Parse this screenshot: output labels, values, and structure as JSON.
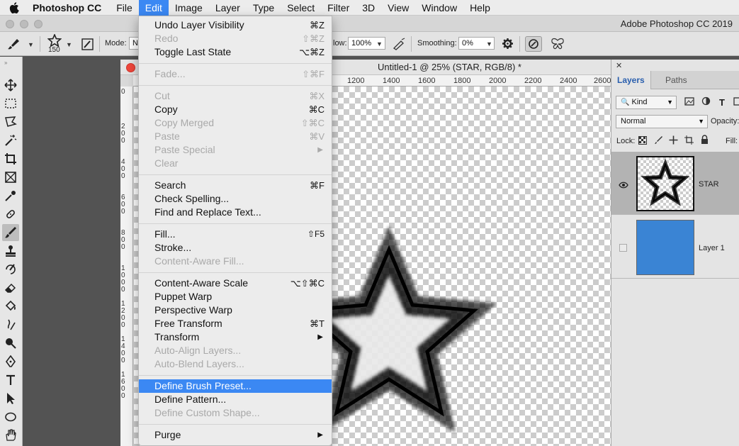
{
  "menubar": {
    "app_name": "Photoshop CC",
    "items": [
      "File",
      "Edit",
      "Image",
      "Layer",
      "Type",
      "Select",
      "Filter",
      "3D",
      "View",
      "Window",
      "Help"
    ],
    "active": "Edit"
  },
  "window": {
    "app_title": "Adobe Photoshop CC 2019"
  },
  "options": {
    "brush_size": "150",
    "mode_label": "Mode:",
    "mode_value": "N",
    "flow_label": "low:",
    "flow_value": "100%",
    "smoothing_label": "Smoothing:",
    "smoothing_value": "0%"
  },
  "document": {
    "title": "Untitled-1 @ 25% (STAR, RGB/8) *",
    "ruler_h": [
      "1200",
      "1400",
      "1600",
      "1800",
      "2000",
      "2200",
      "2400",
      "2600"
    ],
    "ruler_v": [
      "0",
      "2\n0\n0",
      "4\n0\n0",
      "6\n0\n0",
      "8\n0\n0",
      "1\n0\n0\n0",
      "1\n2\n0\n0",
      "1\n4\n0\n0",
      "1\n6\n0\n0"
    ]
  },
  "edit_menu": {
    "groups": [
      [
        {
          "label": "Undo Layer Visibility",
          "shortcut": "⌘Z",
          "enabled": true
        },
        {
          "label": "Redo",
          "shortcut": "⇧⌘Z",
          "enabled": false
        },
        {
          "label": "Toggle Last State",
          "shortcut": "⌥⌘Z",
          "enabled": true
        }
      ],
      [
        {
          "label": "Fade...",
          "shortcut": "⇧⌘F",
          "enabled": false
        }
      ],
      [
        {
          "label": "Cut",
          "shortcut": "⌘X",
          "enabled": false
        },
        {
          "label": "Copy",
          "shortcut": "⌘C",
          "enabled": true
        },
        {
          "label": "Copy Merged",
          "shortcut": "⇧⌘C",
          "enabled": false
        },
        {
          "label": "Paste",
          "shortcut": "⌘V",
          "enabled": false
        },
        {
          "label": "Paste Special",
          "submenu": true,
          "enabled": false
        },
        {
          "label": "Clear",
          "enabled": false
        }
      ],
      [
        {
          "label": "Search",
          "shortcut": "⌘F",
          "enabled": true
        },
        {
          "label": "Check Spelling...",
          "enabled": true
        },
        {
          "label": "Find and Replace Text...",
          "enabled": true
        }
      ],
      [
        {
          "label": "Fill...",
          "shortcut": "⇧F5",
          "enabled": true
        },
        {
          "label": "Stroke...",
          "enabled": true
        },
        {
          "label": "Content-Aware Fill...",
          "enabled": false
        }
      ],
      [
        {
          "label": "Content-Aware Scale",
          "shortcut": "⌥⇧⌘C",
          "enabled": true
        },
        {
          "label": "Puppet Warp",
          "enabled": true
        },
        {
          "label": "Perspective Warp",
          "enabled": true
        },
        {
          "label": "Free Transform",
          "shortcut": "⌘T",
          "enabled": true
        },
        {
          "label": "Transform",
          "submenu": true,
          "enabled": true
        },
        {
          "label": "Auto-Align Layers...",
          "enabled": false
        },
        {
          "label": "Auto-Blend Layers...",
          "enabled": false
        }
      ],
      [
        {
          "label": "Define Brush Preset...",
          "enabled": true,
          "highlighted": true
        },
        {
          "label": "Define Pattern...",
          "enabled": true
        },
        {
          "label": "Define Custom Shape...",
          "enabled": false
        }
      ],
      [
        {
          "label": "Purge",
          "submenu": true,
          "enabled": true
        }
      ]
    ]
  },
  "layers_panel": {
    "tabs": [
      "Layers",
      "Paths"
    ],
    "active_tab": "Layers",
    "filter_kind": "Kind",
    "blend_mode": "Normal",
    "opacity_label": "Opacity:",
    "lock_label": "Lock:",
    "fill_label": "Fill:",
    "layers": [
      {
        "name": "STAR",
        "visible": true,
        "selected": true
      },
      {
        "name": "Layer 1",
        "visible": false,
        "selected": false,
        "color": "#3a84d4"
      }
    ]
  },
  "colors": {
    "accent": "#3b88f3",
    "close_button": "#f0473c",
    "layer1_fill": "#3a84d4"
  }
}
